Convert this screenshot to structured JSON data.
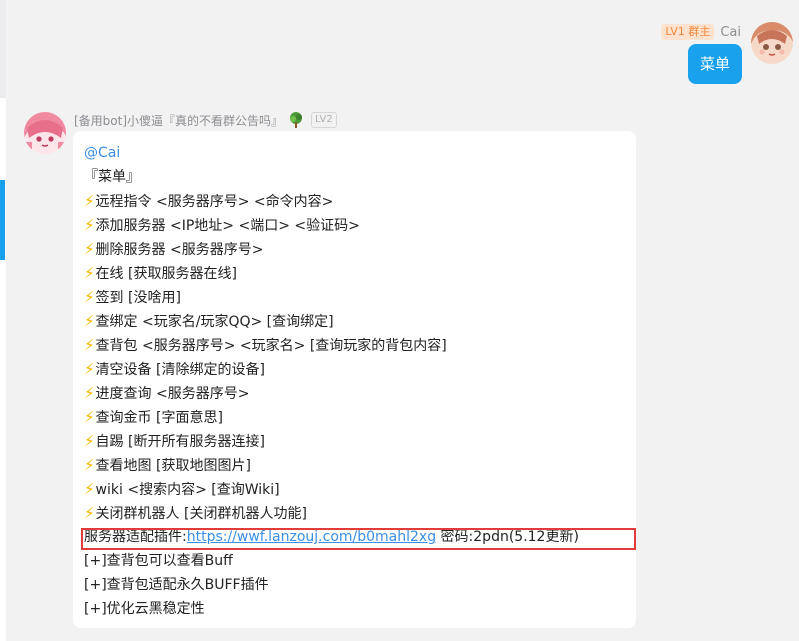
{
  "user": {
    "level_badge": "LV1 群主",
    "name": "Cai",
    "message": "菜单"
  },
  "bot": {
    "name": "[备用bot]小傻逼『真的不看群公告吗』",
    "level_badge": "LV2",
    "mention": "@Cai",
    "title": "『菜单』",
    "commands": [
      "远程指令 <服务器序号> <命令内容>",
      "添加服务器 <IP地址> <端口> <验证码>",
      "删除服务器 <服务器序号>",
      "在线 [获取服务器在线]",
      "签到 [没啥用]",
      "查绑定 <玩家名/玩家QQ> [查询绑定]",
      "查背包 <服务器序号> <玩家名> [查询玩家的背包内容]",
      "清空设备 [清除绑定的设备]",
      "进度查询 <服务器序号>",
      "查询金币 [字面意思]",
      "自踢 [断开所有服务器连接]",
      "查看地图 [获取地图图片]",
      "wiki <搜索内容> [查询Wiki]",
      "关闭群机器人 [关闭群机器人功能]"
    ],
    "plugin_prefix": "服务器适配插件:",
    "plugin_link": "https://wwf.lanzouj.com/b0mahl2xg",
    "plugin_suffix": " 密码:2pdn(5.12更新)",
    "notes": [
      "[+]查背包可以查看Buff",
      "[+]查背包适配永久BUFF插件",
      "[+]优化云黑稳定性"
    ]
  },
  "colors": {
    "accent": "#1aa1ee",
    "highlight_box": "#e23b3b",
    "zap": "#f7b500"
  },
  "icons": {
    "command_bullet": "lightning-icon",
    "bot_title_badge": "tree-icon"
  }
}
